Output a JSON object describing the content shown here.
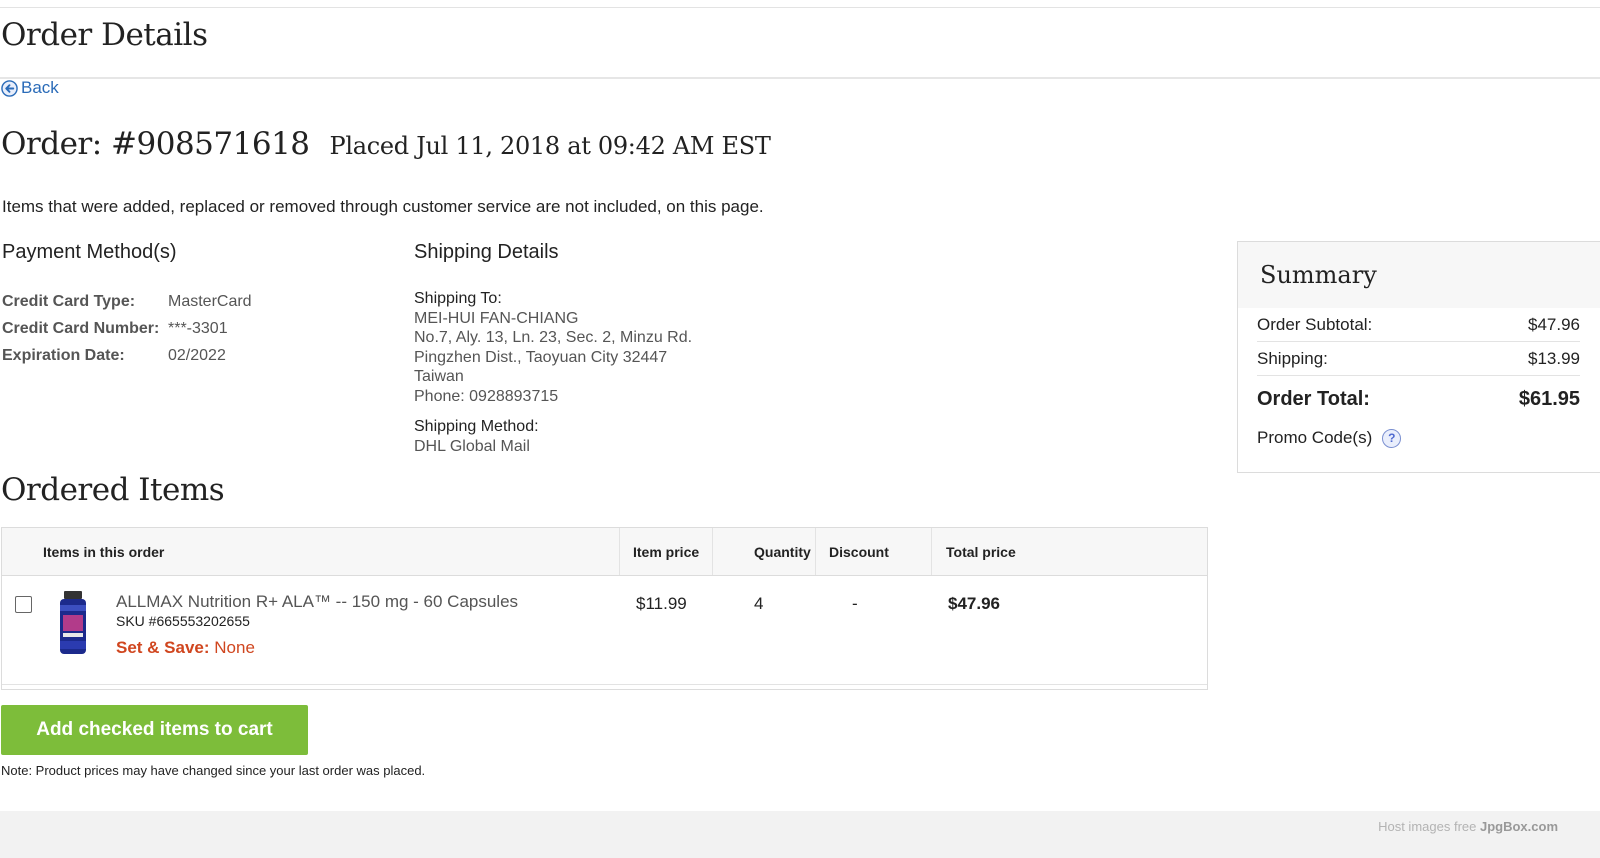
{
  "page": {
    "title": "Order Details",
    "back_label": "Back"
  },
  "order": {
    "number": "Order: #908571618",
    "placed": "Placed Jul 11, 2018 at 09:42 AM EST",
    "notice": "Items that were added, replaced or removed through customer service are not included, on this page."
  },
  "payment": {
    "heading": "Payment Method(s)",
    "rows": [
      {
        "label": "Credit Card Type:",
        "value": "MasterCard"
      },
      {
        "label": "Credit Card Number:",
        "value": "***-3301"
      },
      {
        "label": "Expiration Date:",
        "value": "02/2022"
      }
    ]
  },
  "shipping": {
    "heading": "Shipping Details",
    "to_label": "Shipping To:",
    "name": "MEI-HUI FAN-CHIANG",
    "address_line1": "No.7, Aly. 13, Ln. 23, Sec. 2, Minzu Rd.",
    "address_line2": "Pingzhen Dist., Taoyuan City 32447",
    "country": "Taiwan",
    "phone": "Phone: 0928893715",
    "method_label": "Shipping Method:",
    "method": "DHL Global Mail"
  },
  "summary": {
    "title": "Summary",
    "subtotal_label": "Order Subtotal:",
    "subtotal": "$47.96",
    "shipping_label": "Shipping:",
    "shipping": "$13.99",
    "total_label": "Order Total:",
    "total": "$61.95",
    "promo_label": "Promo Code(s)",
    "help_glyph": "?"
  },
  "items": {
    "heading": "Ordered Items",
    "columns": [
      "Items in this order",
      "Item price",
      "Quantity",
      "Discount",
      "Total price"
    ],
    "rows": [
      {
        "name": "ALLMAX Nutrition R+ ALA™ -- 150 mg - 60 Capsules",
        "sku": "SKU #665553202655",
        "setsave_label": "Set & Save:",
        "setsave_value": "None",
        "price": "$11.99",
        "quantity": "4",
        "discount": "-",
        "total": "$47.96"
      }
    ]
  },
  "actions": {
    "add_to_cart": "Add checked items to cart",
    "note": "Note: Product prices may have changed since your last order was placed."
  },
  "footer": {
    "text_prefix": "Host images free",
    "brand": "JpgBox.com"
  },
  "colors": {
    "link": "#2a6bb8",
    "button": "#7dbd3a",
    "setsave": "#d0461f"
  }
}
